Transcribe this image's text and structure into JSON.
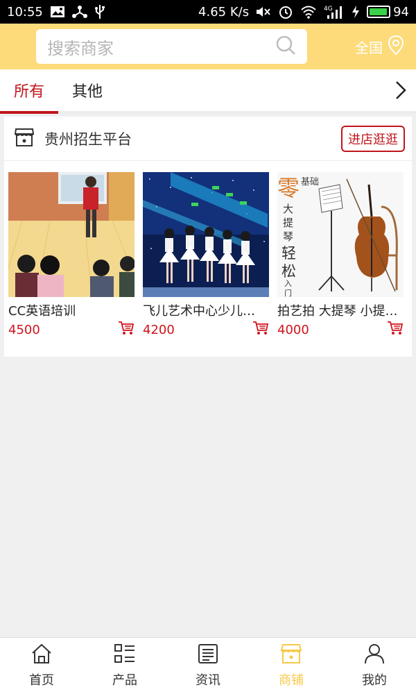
{
  "status_bar": {
    "time": "10:55",
    "speed": "4.65 K/s",
    "network": "4G",
    "battery_level": "94",
    "battery_fraction": 0.94,
    "icons": [
      "image-icon",
      "share-icon",
      "usb-icon",
      "mute-icon",
      "alarm-icon",
      "wifi-icon",
      "signal-icon",
      "charging-icon"
    ]
  },
  "header": {
    "search_placeholder": "搜索商家",
    "region_label": "全国"
  },
  "tabs": [
    {
      "label": "所有",
      "active": true
    },
    {
      "label": "其他",
      "active": false
    }
  ],
  "shop": {
    "name": "贵州招生平台",
    "visit_label": "进店逛逛",
    "products": [
      {
        "name": "CC英语培训",
        "price": "4500"
      },
      {
        "name": "飞儿艺术中心少儿…",
        "price": "4200"
      },
      {
        "name": "拍艺拍 大提琴 小提…",
        "price": "4000"
      }
    ],
    "product3_image_text": {
      "big": "零",
      "small": "基础",
      "lines": [
        "大",
        "提",
        "琴",
        "轻",
        "松",
        "入",
        "门"
      ]
    }
  },
  "bottom_nav": [
    {
      "label": "首页",
      "icon": "home-icon",
      "active": false
    },
    {
      "label": "产品",
      "icon": "grid-list-icon",
      "active": false
    },
    {
      "label": "资讯",
      "icon": "news-icon",
      "active": false
    },
    {
      "label": "商铺",
      "icon": "store-icon",
      "active": true
    },
    {
      "label": "我的",
      "icon": "user-icon",
      "active": false
    }
  ],
  "colors": {
    "header_bg": "#fddb7a",
    "accent_red": "#c0151b",
    "nav_active": "#f7c948"
  }
}
